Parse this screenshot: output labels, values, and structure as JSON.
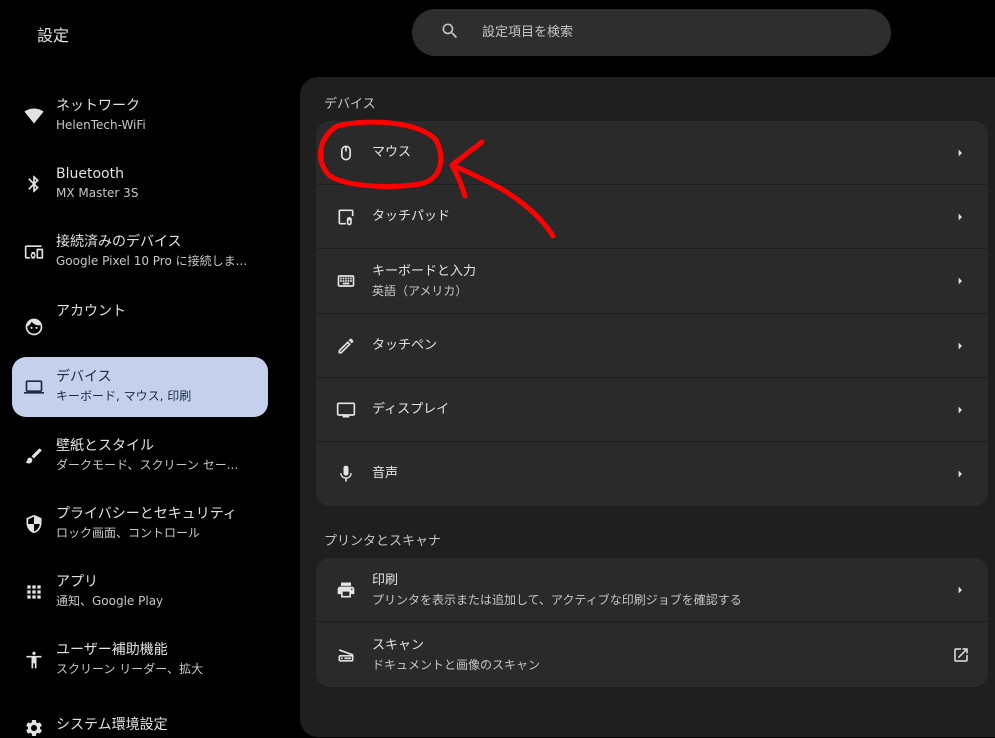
{
  "app": {
    "title": "設定"
  },
  "search": {
    "placeholder": "設定項目を検索"
  },
  "sidebar": {
    "items": [
      {
        "title": "ネットワーク",
        "subtitle": "HelenTech-WiFi",
        "icon": "wifi-icon"
      },
      {
        "title": "Bluetooth",
        "subtitle": "MX Master 3S",
        "icon": "bluetooth-icon"
      },
      {
        "title": "接続済みのデバイス",
        "subtitle": "Google Pixel 10 Pro に接続しま...",
        "icon": "connected-devices-icon"
      },
      {
        "title": "アカウント",
        "subtitle": "",
        "icon": "account-icon"
      },
      {
        "title": "デバイス",
        "subtitle": "キーボード, マウス, 印刷",
        "icon": "laptop-icon",
        "active": true
      },
      {
        "title": "壁紙とスタイル",
        "subtitle": "ダークモード、スクリーン セー...",
        "icon": "wallpaper-style-icon"
      },
      {
        "title": "プライバシーとセキュリティ",
        "subtitle": "ロック画面、コントロール",
        "icon": "shield-icon"
      },
      {
        "title": "アプリ",
        "subtitle": "通知、Google Play",
        "icon": "apps-grid-icon"
      },
      {
        "title": "ユーザー補助機能",
        "subtitle": "スクリーン リーダー、拡大",
        "icon": "accessibility-icon"
      },
      {
        "title": "システム環境設定",
        "subtitle": "",
        "icon": "system-icon"
      }
    ]
  },
  "main": {
    "device_section": {
      "title": "デバイス",
      "rows": [
        {
          "title": "マウス",
          "subtitle": "",
          "icon": "mouse-icon",
          "action": "chevron-right-icon"
        },
        {
          "title": "タッチパッド",
          "subtitle": "",
          "icon": "touchpad-icon",
          "action": "chevron-right-icon"
        },
        {
          "title": "キーボードと入力",
          "subtitle": "英語（アメリカ）",
          "icon": "keyboard-icon",
          "action": "chevron-right-icon"
        },
        {
          "title": "タッチペン",
          "subtitle": "",
          "icon": "stylus-icon",
          "action": "chevron-right-icon"
        },
        {
          "title": "ディスプレイ",
          "subtitle": "",
          "icon": "display-icon",
          "action": "chevron-right-icon"
        },
        {
          "title": "音声",
          "subtitle": "",
          "icon": "microphone-icon",
          "action": "chevron-right-icon"
        }
      ]
    },
    "printer_section": {
      "title": "プリンタとスキャナ",
      "rows": [
        {
          "title": "印刷",
          "subtitle": "プリンタを表示または追加して、アクティブな印刷ジョブを確認する",
          "icon": "printer-icon",
          "action": "chevron-right-icon"
        },
        {
          "title": "スキャン",
          "subtitle": "ドキュメントと画像のスキャン",
          "icon": "scanner-icon",
          "action": "open-external-icon"
        }
      ]
    }
  },
  "annotation": {
    "color": "#ff0000"
  }
}
